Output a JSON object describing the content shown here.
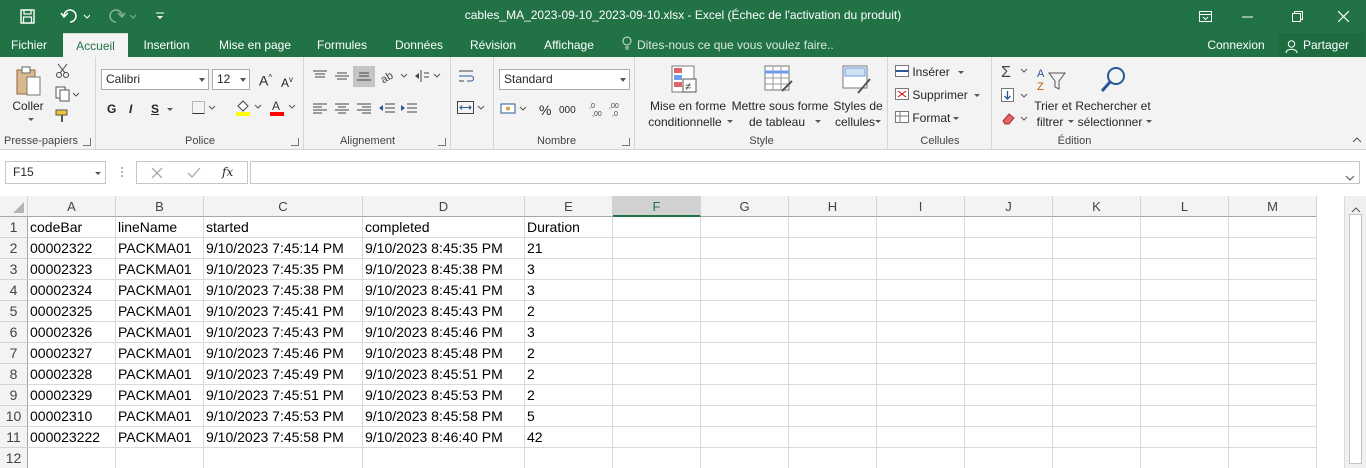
{
  "window": {
    "title": "cables_MA_2023-09-10_2023-09-10.xlsx  -  Excel (Échec de l'activation du produit)",
    "accent": "#217346"
  },
  "quick_access": [
    "save-icon",
    "undo-icon",
    "redo-icon",
    "customize-icon"
  ],
  "window_controls": [
    "ribbon-display-icon",
    "minimize-icon",
    "restore-icon",
    "close-icon"
  ],
  "tabs": [
    "Fichier",
    "Accueil",
    "Insertion",
    "Mise en page",
    "Formules",
    "Données",
    "Révision",
    "Affichage"
  ],
  "active_tab": "Accueil",
  "tell_me": "Dites-nous ce que vous voulez faire..",
  "signin": "Connexion",
  "share": "Partager",
  "ribbon": {
    "clipboard": {
      "label": "Presse-papiers",
      "paste": "Coller"
    },
    "font": {
      "label": "Police",
      "family": "Calibri",
      "size": "12",
      "bold": "G",
      "italic": "I",
      "underline": "S"
    },
    "alignment": {
      "label": "Alignement"
    },
    "number": {
      "label": "Nombre",
      "format": "Standard",
      "percent": "%",
      "thousands": "000"
    },
    "styles": {
      "label": "Style",
      "conditional": [
        "Mise en forme",
        "conditionnelle"
      ],
      "table": [
        "Mettre sous forme",
        "de tableau"
      ],
      "cell_styles": [
        "Styles de",
        "cellules"
      ]
    },
    "cells": {
      "label": "Cellules",
      "insert": "Insérer",
      "delete": "Supprimer",
      "format": "Format"
    },
    "editing": {
      "label": "Édition",
      "sort": [
        "Trier et",
        "filtrer"
      ],
      "find": [
        "Rechercher et",
        "sélectionner"
      ]
    }
  },
  "formula_bar": {
    "name_box": "F15",
    "fx": "fx",
    "content": ""
  },
  "columns": [
    "A",
    "B",
    "C",
    "D",
    "E",
    "F",
    "G",
    "H",
    "I",
    "J",
    "K",
    "L",
    "M"
  ],
  "selected_column": "F",
  "rows": [
    [
      "codeBar",
      "lineName",
      "started",
      "completed",
      "Duration"
    ],
    [
      "00002322",
      "PACKMA01",
      "9/10/2023 7:45:14 PM",
      "9/10/2023 8:45:35 PM",
      "21"
    ],
    [
      "00002323",
      "PACKMA01",
      "9/10/2023 7:45:35 PM",
      "9/10/2023 8:45:38 PM",
      "3"
    ],
    [
      "00002324",
      "PACKMA01",
      "9/10/2023 7:45:38 PM",
      "9/10/2023 8:45:41 PM",
      "3"
    ],
    [
      "00002325",
      "PACKMA01",
      "9/10/2023 7:45:41 PM",
      "9/10/2023 8:45:43 PM",
      "2"
    ],
    [
      "00002326",
      "PACKMA01",
      "9/10/2023 7:45:43 PM",
      "9/10/2023 8:45:46 PM",
      "3"
    ],
    [
      "00002327",
      "PACKMA01",
      "9/10/2023 7:45:46 PM",
      "9/10/2023 8:45:48 PM",
      "2"
    ],
    [
      "00002328",
      "PACKMA01",
      "9/10/2023 7:45:49 PM",
      "9/10/2023 8:45:51 PM",
      "2"
    ],
    [
      "00002329",
      "PACKMA01",
      "9/10/2023 7:45:51 PM",
      "9/10/2023 8:45:53 PM",
      "2"
    ],
    [
      "00002310",
      "PACKMA01",
      "9/10/2023 7:45:53 PM",
      "9/10/2023 8:45:58 PM",
      "5"
    ],
    [
      "000023222",
      "PACKMA01",
      "9/10/2023 7:45:58 PM",
      "9/10/2023 8:46:40 PM",
      "42"
    ],
    [
      "",
      "",
      "",
      "",
      ""
    ]
  ]
}
